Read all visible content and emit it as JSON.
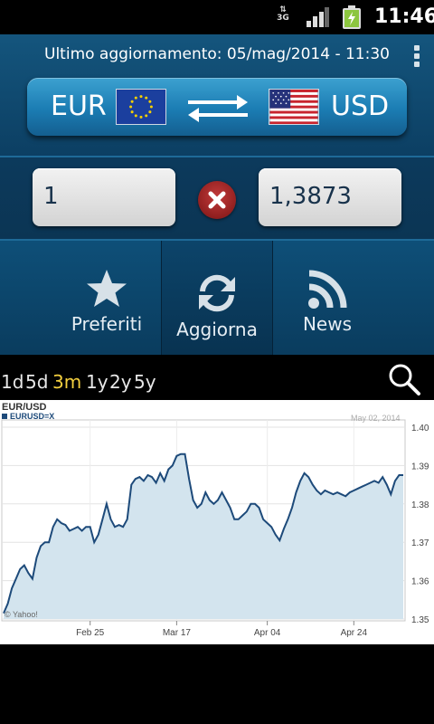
{
  "status_bar": {
    "network": "3G",
    "time": "11:46"
  },
  "header": {
    "last_update": "Ultimo aggiornamento: 05/mag/2014 - 11:30"
  },
  "pair": {
    "from_currency": "EUR",
    "to_currency": "USD"
  },
  "conversion": {
    "amount": "1",
    "result": "1,3873"
  },
  "toolbar": {
    "favorites_label": "Preferiti",
    "refresh_label": "Aggiorna",
    "news_label": "News"
  },
  "ranges": [
    "1d",
    "5d",
    "3m",
    "1y",
    "2y",
    "5y"
  ],
  "active_range": "3m",
  "colors": {
    "accent": "#f4d03f",
    "header_blue": "#1b7cb3",
    "chart_line": "#1d4a7a",
    "chart_fill": "#d3e4ee"
  },
  "chart_data": {
    "type": "area",
    "title": "EUR/USD",
    "legend": "EURUSD=X",
    "date_label": "May 02, 2014",
    "watermark": "© Yahoo!",
    "x_ticks": [
      "Feb 25",
      "Mar 17",
      "Apr 04",
      "Apr 24"
    ],
    "y_ticks": [
      "1.40",
      "1.39",
      "1.38",
      "1.37",
      "1.36",
      "1.35"
    ],
    "ylim": [
      1.35,
      1.4
    ],
    "y_axis_side": "right",
    "grid": true,
    "values": [
      1.3515,
      1.354,
      1.358,
      1.3605,
      1.363,
      1.364,
      1.362,
      1.3605,
      1.366,
      1.369,
      1.37,
      1.37,
      1.374,
      1.376,
      1.375,
      1.3745,
      1.373,
      1.3735,
      1.374,
      1.373,
      1.374,
      1.374,
      1.37,
      1.372,
      1.376,
      1.38,
      1.376,
      1.374,
      1.3745,
      1.374,
      1.376,
      1.385,
      1.3865,
      1.387,
      1.386,
      1.3875,
      1.387,
      1.3855,
      1.388,
      1.386,
      1.389,
      1.39,
      1.3925,
      1.393,
      1.393,
      1.3865,
      1.381,
      1.379,
      1.38,
      1.383,
      1.381,
      1.38,
      1.381,
      1.383,
      1.381,
      1.379,
      1.376,
      1.376,
      1.377,
      1.378,
      1.38,
      1.38,
      1.379,
      1.376,
      1.375,
      1.374,
      1.372,
      1.3705,
      1.3735,
      1.376,
      1.379,
      1.383,
      1.386,
      1.388,
      1.387,
      1.385,
      1.3835,
      1.3825,
      1.3835,
      1.383,
      1.3825,
      1.383,
      1.3825,
      1.382,
      1.383,
      1.3835,
      1.384,
      1.3845,
      1.385,
      1.3855,
      1.386,
      1.3855,
      1.387,
      1.385,
      1.3825,
      1.386,
      1.3875,
      1.3875
    ]
  }
}
